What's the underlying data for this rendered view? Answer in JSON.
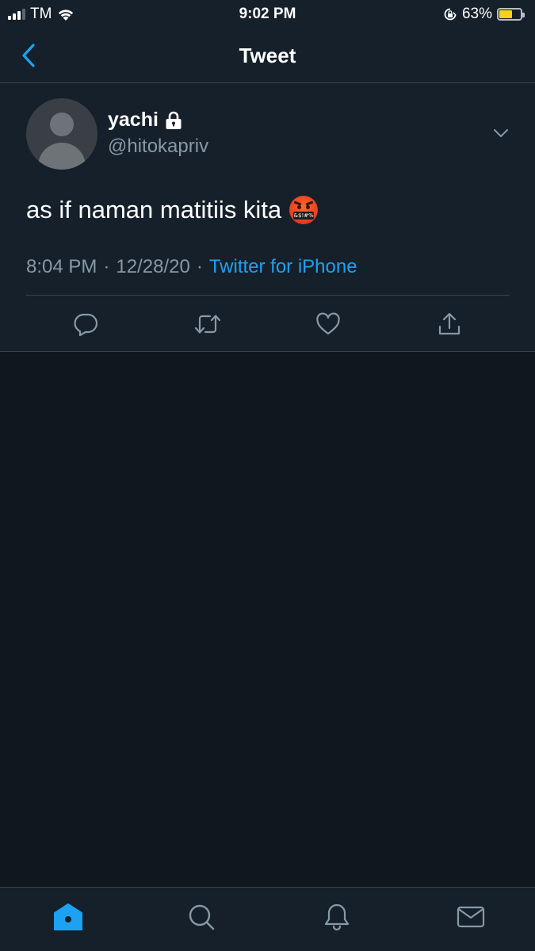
{
  "status_bar": {
    "carrier": "TM",
    "time": "9:02 PM",
    "battery_percent": "63%",
    "battery_level": 0.63,
    "battery_color": "#f6d21c"
  },
  "nav": {
    "back_icon": "chevron-left-icon",
    "title": "Tweet"
  },
  "tweet": {
    "user": {
      "name": "yachi",
      "protected_icon": "lock-icon",
      "handle": "@hitokapriv"
    },
    "text": "as if naman matitiis kita",
    "emoji": "face-with-symbols-on-mouth",
    "emoji_symbols": "&$!#%",
    "time": "8:04 PM",
    "date": "12/28/20",
    "separator": "·",
    "source": "Twitter for iPhone",
    "actions": [
      "reply-icon",
      "retweet-icon",
      "like-icon",
      "share-icon"
    ]
  },
  "tab_bar": {
    "items": [
      "home-icon",
      "search-icon",
      "notifications-icon",
      "messages-icon"
    ],
    "active": "home-icon"
  },
  "colors": {
    "accent": "#1da1f2",
    "background": "#10171e",
    "surface": "#15202b",
    "secondary_text": "#8899a6",
    "border": "#38444d"
  }
}
